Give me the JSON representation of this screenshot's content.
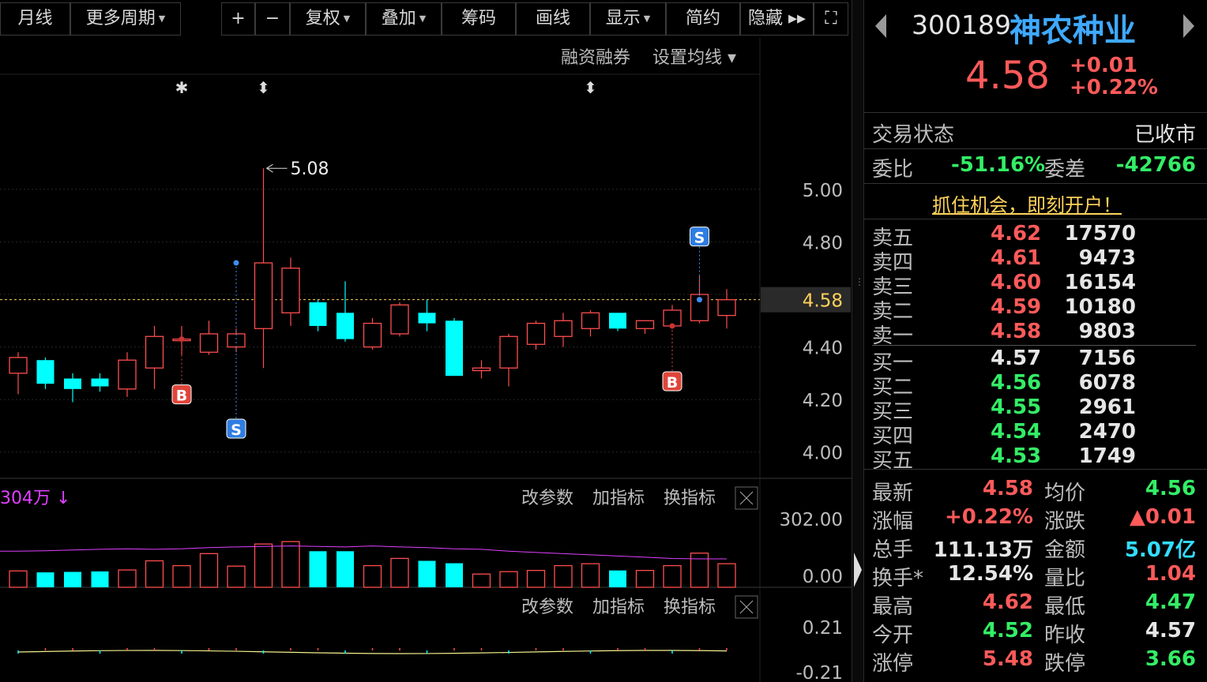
{
  "toolbar": {
    "items": [
      {
        "label": "月线",
        "caret": false
      },
      {
        "label": "更多周期",
        "caret": true
      },
      {
        "label": "+",
        "caret": false
      },
      {
        "label": "−",
        "caret": false
      },
      {
        "label": "复权",
        "caret": true
      },
      {
        "label": "叠加",
        "caret": true
      },
      {
        "label": "筹码",
        "caret": false
      },
      {
        "label": "画线",
        "caret": false
      },
      {
        "label": "显示",
        "caret": true
      },
      {
        "label": "简约",
        "caret": false
      },
      {
        "label": "隐藏 ▸▸",
        "caret": false
      },
      {
        "label": "⛶",
        "caret": false
      }
    ]
  },
  "chart_header": {
    "margin": "融资融券",
    "ma_setting": "设置均线 ▾"
  },
  "chart_data": {
    "type": "candlestick",
    "ylim": [
      3.9,
      5.3
    ],
    "yticks": [
      "5.00",
      "4.80",
      "4.40",
      "4.20",
      "4.00"
    ],
    "current_price": "4.58",
    "max_label": "5.08",
    "candles": [
      {
        "o": 4.3,
        "c": 4.36,
        "h": 4.38,
        "l": 4.22
      },
      {
        "o": 4.35,
        "c": 4.26,
        "h": 4.36,
        "l": 4.24
      },
      {
        "o": 4.28,
        "c": 4.24,
        "h": 4.3,
        "l": 4.19
      },
      {
        "o": 4.28,
        "c": 4.25,
        "h": 4.3,
        "l": 4.23
      },
      {
        "o": 4.24,
        "c": 4.35,
        "h": 4.38,
        "l": 4.21
      },
      {
        "o": 4.32,
        "c": 4.44,
        "h": 4.48,
        "l": 4.24
      },
      {
        "o": 4.43,
        "c": 4.43,
        "h": 4.48,
        "l": 4.37
      },
      {
        "o": 4.38,
        "c": 4.45,
        "h": 4.5,
        "l": 4.37
      },
      {
        "o": 4.4,
        "c": 4.45,
        "h": 4.47,
        "l": 4.38
      },
      {
        "o": 4.47,
        "c": 4.72,
        "h": 5.08,
        "l": 4.32
      },
      {
        "o": 4.53,
        "c": 4.7,
        "h": 4.74,
        "l": 4.48
      },
      {
        "o": 4.57,
        "c": 4.48,
        "h": 4.58,
        "l": 4.46
      },
      {
        "o": 4.53,
        "c": 4.43,
        "h": 4.65,
        "l": 4.42
      },
      {
        "o": 4.4,
        "c": 4.49,
        "h": 4.51,
        "l": 4.39
      },
      {
        "o": 4.45,
        "c": 4.56,
        "h": 4.57,
        "l": 4.44
      },
      {
        "o": 4.53,
        "c": 4.49,
        "h": 4.58,
        "l": 4.46
      },
      {
        "o": 4.5,
        "c": 4.29,
        "h": 4.51,
        "l": 4.29
      },
      {
        "o": 4.31,
        "c": 4.32,
        "h": 4.35,
        "l": 4.28
      },
      {
        "o": 4.32,
        "c": 4.44,
        "h": 4.45,
        "l": 4.25
      },
      {
        "o": 4.41,
        "c": 4.49,
        "h": 4.5,
        "l": 4.39
      },
      {
        "o": 4.44,
        "c": 4.5,
        "h": 4.53,
        "l": 4.4
      },
      {
        "o": 4.47,
        "c": 4.53,
        "h": 4.54,
        "l": 4.44
      },
      {
        "o": 4.53,
        "c": 4.47,
        "h": 4.53,
        "l": 4.46
      },
      {
        "o": 4.47,
        "c": 4.5,
        "h": 4.5,
        "l": 4.45
      },
      {
        "o": 4.48,
        "c": 4.54,
        "h": 4.56,
        "l": 4.47
      },
      {
        "o": 4.5,
        "c": 4.6,
        "h": 4.67,
        "l": 4.49
      },
      {
        "o": 4.52,
        "c": 4.58,
        "h": 4.62,
        "l": 4.47
      }
    ],
    "marks": [
      {
        "i": 6,
        "type": "star"
      },
      {
        "i": 9,
        "type": "diamond"
      },
      {
        "i": 21,
        "type": "diamond"
      }
    ],
    "signals": [
      {
        "i": 6,
        "label": "B",
        "price": 4.43,
        "side": "below"
      },
      {
        "i": 8,
        "label": "S",
        "price": 4.72,
        "side": "below"
      },
      {
        "i": 24,
        "label": "B",
        "price": 4.48,
        "side": "below"
      },
      {
        "i": 25,
        "label": "S",
        "price": 4.58,
        "side": "above"
      }
    ],
    "volume": {
      "label": "304万 ↓",
      "yticks": [
        "302.00",
        "0.00"
      ],
      "vmax": 302,
      "values": [
        68,
        62,
        64,
        66,
        72,
        110,
        90,
        140,
        88,
        180,
        190,
        150,
        150,
        90,
        120,
        110,
        100,
        55,
        65,
        70,
        90,
        98,
        70,
        70,
        90,
        142,
        98
      ],
      "ma": [
        150,
        152,
        155,
        158,
        160,
        158,
        160,
        165,
        168,
        170,
        172,
        170,
        168,
        172,
        168,
        165,
        160,
        158,
        150,
        145,
        140,
        135,
        130,
        125,
        120,
        118,
        118
      ]
    },
    "macd": {
      "yticks": [
        "0.21",
        "-0.21"
      ]
    },
    "panel_buttons": [
      "改参数",
      "加指标",
      "换指标"
    ]
  },
  "quote": {
    "code": "300189",
    "name": "神农种业",
    "price": "4.58",
    "change": "+0.01",
    "change_pct": "+0.22%",
    "trade_status_label": "交易状态",
    "trade_status": "已收市",
    "weibi_label": "委比",
    "weibi": "-51.16%",
    "weicha_label": "委差",
    "weicha": "-42766",
    "promo": "抓住机会，即刻开户！",
    "asks": [
      {
        "label": "卖五",
        "price": "4.62",
        "vol": "17570"
      },
      {
        "label": "卖四",
        "price": "4.61",
        "vol": "9473"
      },
      {
        "label": "卖三",
        "price": "4.60",
        "vol": "16154"
      },
      {
        "label": "卖二",
        "price": "4.59",
        "vol": "10180"
      },
      {
        "label": "卖一",
        "price": "4.58",
        "vol": "9803"
      }
    ],
    "bids": [
      {
        "label": "买一",
        "price": "4.57",
        "vol": "7156"
      },
      {
        "label": "买二",
        "price": "4.56",
        "vol": "6078"
      },
      {
        "label": "买三",
        "price": "4.55",
        "vol": "2961"
      },
      {
        "label": "买四",
        "price": "4.54",
        "vol": "2470"
      },
      {
        "label": "买五",
        "price": "4.53",
        "vol": "1749"
      }
    ],
    "stats": [
      {
        "l1": "最新",
        "v1": "4.58",
        "c1": "red",
        "l2": "均价",
        "v2": "4.56",
        "c2": "green"
      },
      {
        "l1": "涨幅",
        "v1": "+0.22%",
        "c1": "red",
        "l2": "涨跌",
        "v2": "▲0.01",
        "c2": "red"
      },
      {
        "l1": "总手",
        "v1": "111.13万",
        "c1": "white",
        "l2": "金额",
        "v2": "5.07亿",
        "c2": "cyan"
      },
      {
        "l1": "换手*",
        "v1": "12.54%",
        "c1": "white",
        "l2": "量比",
        "v2": "1.04",
        "c2": "red"
      },
      {
        "l1": "最高",
        "v1": "4.62",
        "c1": "red",
        "l2": "最低",
        "v2": "4.47",
        "c2": "green"
      },
      {
        "l1": "今开",
        "v1": "4.52",
        "c1": "green",
        "l2": "昨收",
        "v2": "4.57",
        "c2": "white"
      },
      {
        "l1": "涨停",
        "v1": "5.48",
        "c1": "red",
        "l2": "跌停",
        "v2": "3.66",
        "c2": "green"
      }
    ]
  },
  "colors": {
    "up": "#ff4d4d",
    "down": "#00ffff",
    "grid": "#262626",
    "gold": "#ffd35a",
    "magenta": "#e040ff",
    "blue_name": "#3fa9ff"
  }
}
